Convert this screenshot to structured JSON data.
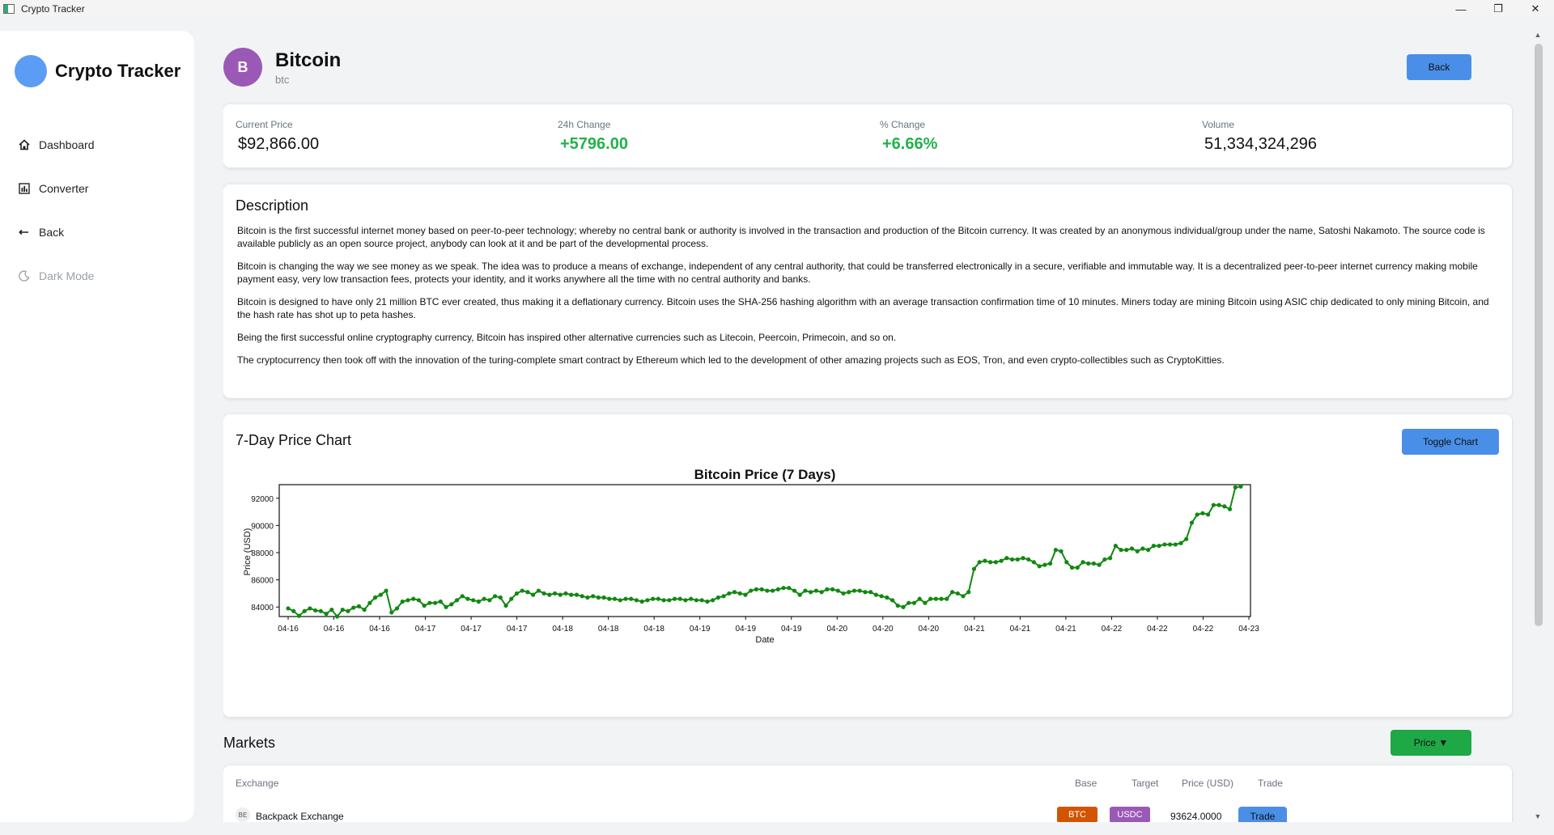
{
  "window": {
    "title": "Crypto Tracker",
    "minimize": "—",
    "maximize": "❐",
    "close": "✕"
  },
  "sidebar": {
    "brand": "Crypto Tracker",
    "items": [
      {
        "label": "Dashboard",
        "icon": "home-icon"
      },
      {
        "label": "Converter",
        "icon": "bar-chart-icon"
      },
      {
        "label": "Back",
        "icon": "arrow-left-icon"
      },
      {
        "label": "Dark Mode",
        "icon": "moon-icon"
      }
    ]
  },
  "header": {
    "avatar_letter": "B",
    "name": "Bitcoin",
    "symbol": "btc",
    "back_label": "Back"
  },
  "stats": [
    {
      "label": "Current Price",
      "value": "$92,866.00"
    },
    {
      "label": "24h Change",
      "value": "+5796.00"
    },
    {
      "label": "% Change",
      "value": "+6.66%"
    },
    {
      "label": "Volume",
      "value": "51,334,324,296"
    }
  ],
  "description": {
    "title": "Description",
    "paragraphs": [
      "Bitcoin is the first successful internet money based on peer-to-peer technology; whereby no central bank or authority is involved in the transaction and production of the Bitcoin currency. It was created by an anonymous individual/group under the name, Satoshi Nakamoto. The source code is available publicly as an open source project, anybody can look at it and be part of the developmental process.",
      "Bitcoin is changing the way we see money as we speak. The idea was to produce a means of exchange, independent of any central authority, that could be transferred electronically in a secure, verifiable and immutable way. It is a decentralized peer-to-peer internet currency making mobile payment easy, very low transaction fees, protects your identity, and it works anywhere all the time with no central authority and banks.",
      "Bitcoin is designed to have only 21 million BTC ever created, thus making it a deflationary currency. Bitcoin uses the SHA-256 hashing algorithm with an average transaction confirmation time of 10 minutes. Miners today are mining Bitcoin using ASIC chip dedicated to only mining Bitcoin, and the hash rate has shot up to peta hashes.",
      "Being the first successful online cryptography currency, Bitcoin has inspired other alternative currencies such as Litecoin, Peercoin, Primecoin, and so on.",
      "The cryptocurrency then took off with the innovation of the turing-complete smart contract by Ethereum which led to the development of other amazing projects such as EOS, Tron, and even crypto-collectibles such as CryptoKitties."
    ]
  },
  "chart_section": {
    "title": "7-Day Price Chart",
    "toggle_label": "Toggle Chart"
  },
  "chart_data": {
    "type": "line",
    "title": "Bitcoin Price (7 Days)",
    "xlabel": "Date",
    "ylabel": "Price (USD)",
    "ylim": [
      83300,
      93000
    ],
    "yticks": [
      84000,
      86000,
      88000,
      90000,
      92000
    ],
    "xticks": [
      "04-16",
      "04-16",
      "04-16",
      "04-17",
      "04-17",
      "04-17",
      "04-18",
      "04-18",
      "04-18",
      "04-19",
      "04-19",
      "04-19",
      "04-20",
      "04-20",
      "04-20",
      "04-21",
      "04-21",
      "04-21",
      "04-22",
      "04-22",
      "04-22",
      "04-23"
    ],
    "color": "#118811",
    "grid": false,
    "series": [
      {
        "values": [
          83900,
          83700,
          83350,
          83700,
          83900,
          83750,
          83700,
          83500,
          83800,
          83300,
          83800,
          83700,
          83950,
          84050,
          83800,
          84300,
          84700,
          84900,
          85200,
          83600,
          83900,
          84400,
          84500,
          84600,
          84500,
          84100,
          84300,
          84300,
          84400,
          84000,
          84200,
          84500,
          84800,
          84600,
          84500,
          84400,
          84600,
          84500,
          84800,
          84700,
          84100,
          84600,
          85000,
          85200,
          85100,
          84900,
          85200,
          85000,
          84900,
          85000,
          84900,
          85000,
          84900,
          84900,
          84800,
          84700,
          84800,
          84700,
          84700,
          84600,
          84600,
          84500,
          84600,
          84600,
          84500,
          84400,
          84500,
          84600,
          84600,
          84500,
          84500,
          84600,
          84600,
          84500,
          84600,
          84500,
          84500,
          84400,
          84500,
          84700,
          84800,
          85000,
          85100,
          85000,
          84900,
          85200,
          85300,
          85300,
          85200,
          85200,
          85300,
          85400,
          85400,
          85200,
          84900,
          85200,
          85100,
          85200,
          85100,
          85300,
          85300,
          85200,
          85000,
          85100,
          85200,
          85200,
          85100,
          85100,
          84900,
          84800,
          84700,
          84500,
          84100,
          84000,
          84300,
          84300,
          84600,
          84300,
          84600,
          84600,
          84600,
          84600,
          85100,
          85000,
          84800,
          85100,
          86800,
          87300,
          87400,
          87300,
          87300,
          87400,
          87600,
          87500,
          87500,
          87600,
          87500,
          87300,
          87000,
          87100,
          87200,
          88200,
          88100,
          87300,
          86900,
          86900,
          87300,
          87200,
          87200,
          87100,
          87500,
          87600,
          88500,
          88200,
          88200,
          88300,
          88100,
          88300,
          88200,
          88500,
          88500,
          88600,
          88600,
          88600,
          88700,
          89000,
          90200,
          90800,
          90900,
          90800,
          91500,
          91500,
          91400,
          91200,
          92800,
          92866
        ]
      }
    ]
  },
  "markets": {
    "title": "Markets",
    "sort_label": "Price ▼",
    "columns": [
      "Exchange",
      "Base",
      "Target",
      "Price (USD)",
      "Trade"
    ],
    "rows": [
      {
        "logo": "BE",
        "exchange": "Backpack Exchange",
        "base": "BTC",
        "target": "USDC",
        "price": "93624.0000",
        "trade": "Trade"
      }
    ]
  },
  "colors": {
    "accent": "#4a8fe7",
    "positive": "#22b14c",
    "avatar": "#9b59b6",
    "base_badge": "#d35400",
    "target_badge": "#9b59b6"
  }
}
